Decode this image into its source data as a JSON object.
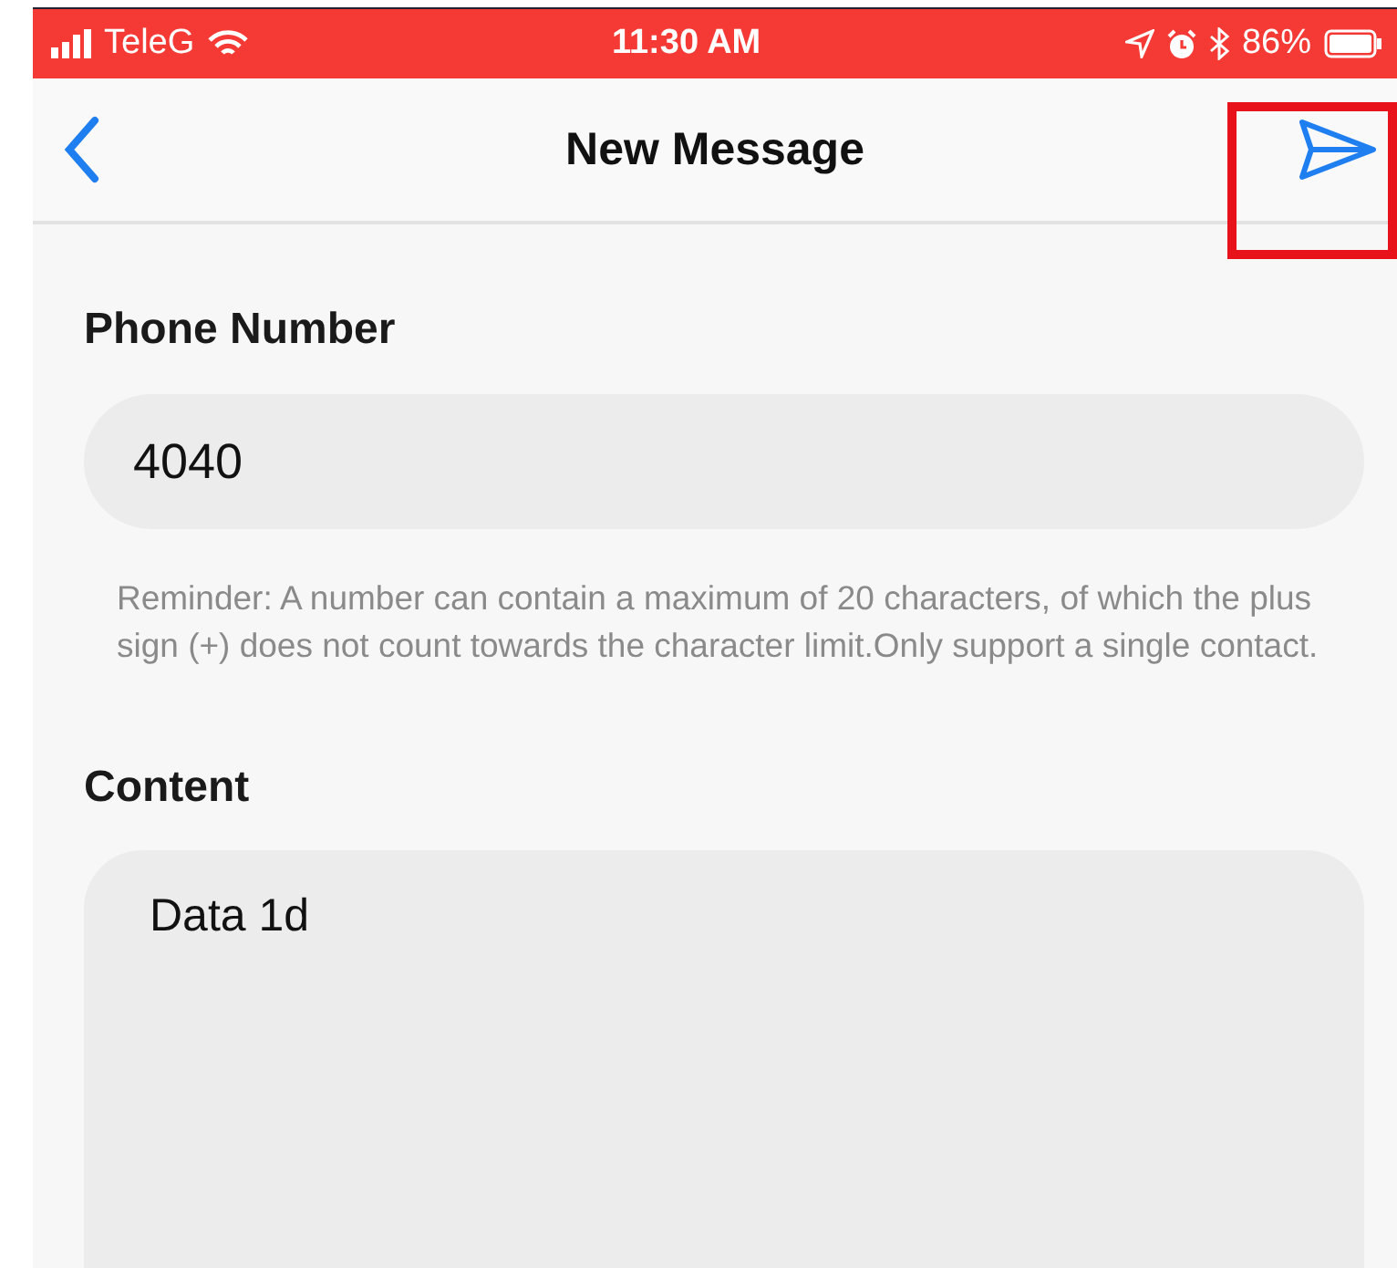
{
  "status_bar": {
    "carrier": "TeleG",
    "time": "11:30 AM",
    "battery_percent": "86%"
  },
  "nav_bar": {
    "title": "New Message"
  },
  "phone_number": {
    "label": "Phone Number",
    "value": "4040",
    "hint": "Reminder: A number can contain a maximum of 20 characters, of which the plus sign (+) does not count towards the character limit.Only support a single contact."
  },
  "content": {
    "label": "Content",
    "value": "Data 1d"
  }
}
